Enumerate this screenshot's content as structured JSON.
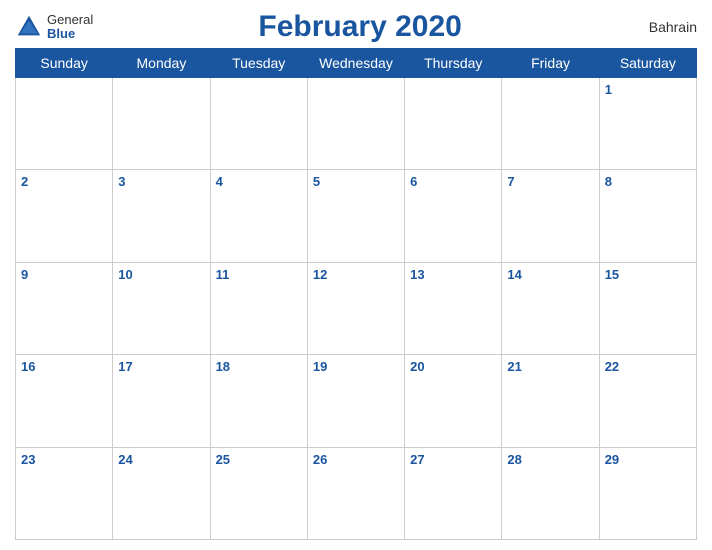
{
  "header": {
    "logo_general": "General",
    "logo_blue": "Blue",
    "title": "February 2020",
    "country": "Bahrain"
  },
  "weekdays": [
    "Sunday",
    "Monday",
    "Tuesday",
    "Wednesday",
    "Thursday",
    "Friday",
    "Saturday"
  ],
  "weeks": [
    [
      null,
      null,
      null,
      null,
      null,
      null,
      1
    ],
    [
      2,
      3,
      4,
      5,
      6,
      7,
      8
    ],
    [
      9,
      10,
      11,
      12,
      13,
      14,
      15
    ],
    [
      16,
      17,
      18,
      19,
      20,
      21,
      22
    ],
    [
      23,
      24,
      25,
      26,
      27,
      28,
      29
    ]
  ]
}
